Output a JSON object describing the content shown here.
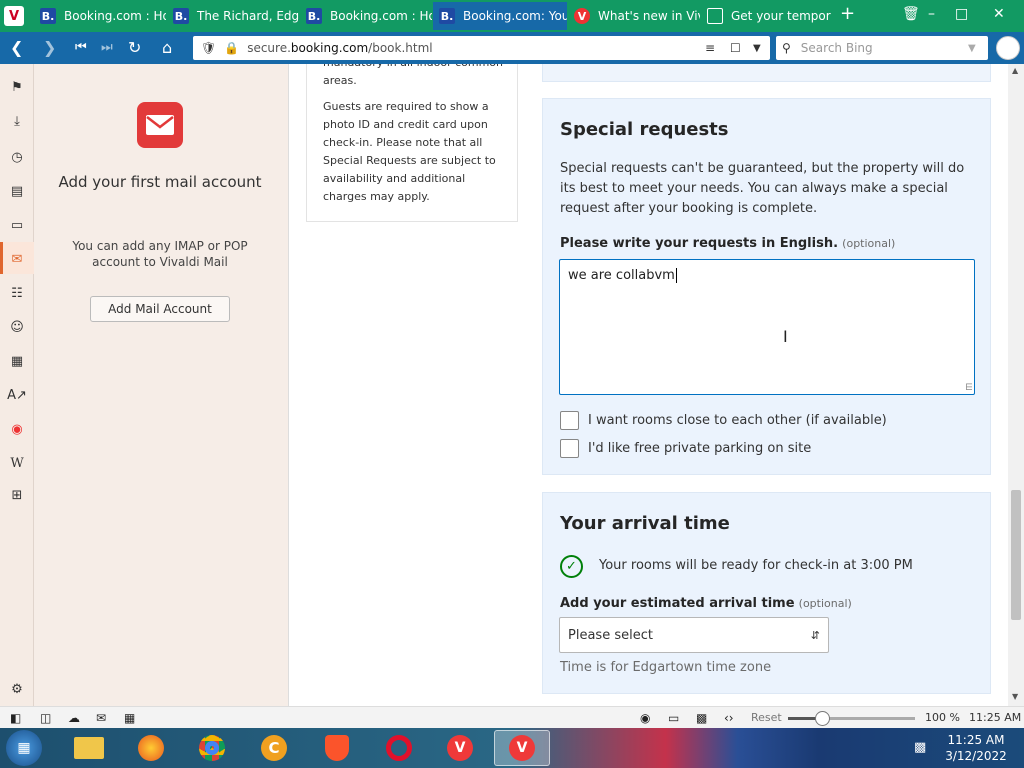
{
  "browser": {
    "tabs": [
      {
        "label": "Booking.com : Hot",
        "icon": "booking-favicon"
      },
      {
        "label": "The Richard, Edga",
        "icon": "booking-favicon"
      },
      {
        "label": "Booking.com : Hot",
        "icon": "booking-favicon"
      },
      {
        "label": "Booking.com: You",
        "icon": "booking-favicon",
        "active": true
      },
      {
        "label": "What's new in Viva",
        "icon": "vivaldi-favicon"
      },
      {
        "label": "Get your temporar",
        "icon": "mail-favicon"
      }
    ],
    "url_prefix": "secure.",
    "url_domain": "booking.com",
    "url_path": "/book.html",
    "search_placeholder": "Search Bing"
  },
  "mail_panel": {
    "title": "Add your first mail account",
    "description": "You can add any IMAP or POP account to Vivaldi Mail",
    "button_label": "Add Mail Account"
  },
  "policy": {
    "clipped_text": "mandatory in all indoor common",
    "line2": "areas.",
    "paragraph": "Guests are required to show a photo ID and credit card upon check-in. Please note that all Special Requests are subject to availability and additional charges may apply."
  },
  "special_requests": {
    "heading": "Special requests",
    "description": "Special requests can't be guaranteed, but the property will do its best to meet your needs. You can always make a special request after your booking is complete.",
    "field_label": "Please write your requests in English.",
    "field_optional": "(optional)",
    "field_value": "we are collabvm",
    "checkbox1_label": "I want rooms close to each other (if available)",
    "checkbox2_label": "I'd like free private parking on site"
  },
  "arrival": {
    "heading": "Your arrival time",
    "ready_text": "Your rooms will be ready for check-in at 3:00 PM",
    "select_label": "Add your estimated arrival time",
    "select_optional": "(optional)",
    "select_value": "Please select",
    "timezone_note": "Time is for Edgartown time zone"
  },
  "status_bar": {
    "reset_label": "Reset",
    "zoom": "100 %",
    "zoom_level": 0.27,
    "time": "11:25 AM"
  },
  "taskbar": {
    "time": "11:25 AM",
    "date": "3/12/2022"
  },
  "colors": {
    "tabbar": "#129a63",
    "addressbar": "#1769a8",
    "accent": "#0071c2",
    "success": "#008009"
  }
}
